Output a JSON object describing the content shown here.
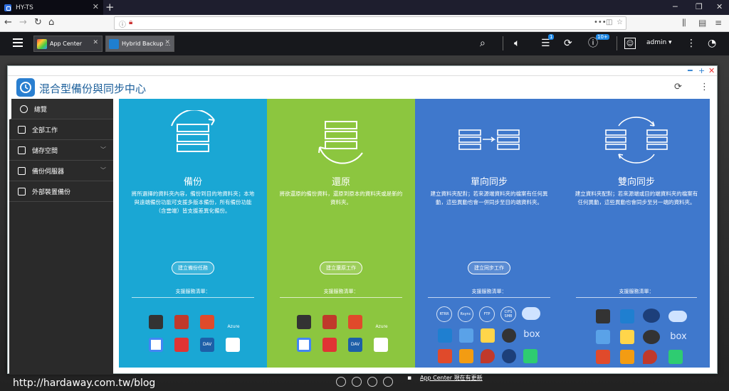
{
  "browser": {
    "tab_title": "HY-TS",
    "new_tab": "+",
    "url": "",
    "min": "─",
    "restore": "❐",
    "close": "✕"
  },
  "qnap": {
    "tabs": [
      {
        "label": "App Center",
        "close": "✕"
      },
      {
        "label": "Hybrid Backup ...",
        "close": "✕"
      }
    ],
    "user": "admin ▾",
    "badges": {
      "notify": "1",
      "info": "10+"
    }
  },
  "window": {
    "title": "混合型備份與同步中心",
    "min": "━",
    "max": "+",
    "close": "✕"
  },
  "sidebar": {
    "items": [
      {
        "label": "總覽"
      },
      {
        "label": "全部工作"
      },
      {
        "label": "儲存空間"
      },
      {
        "label": "備份伺服器"
      },
      {
        "label": "外部裝置備份"
      }
    ]
  },
  "panels": [
    {
      "title": "備份",
      "desc": "將所選擇的資料夾內容，備份到目的地資料夾；本地與遠端備份功能可支援多版本備份，所有備份功能（含雲端）皆支援差異化備份。",
      "button": "建立備份任務",
      "services_label": "支援服務清單：",
      "color": "#1aa7d4"
    },
    {
      "title": "還原",
      "desc": "將欲還原的備份資料，還原到原本的資料夾或是新的資料夾。",
      "button": "建立還原工作",
      "services_label": "支援服務清單：",
      "color": "#8cc63f"
    },
    {
      "title": "單向同步",
      "desc": "建立資料夾配對；若來源端資料夾的檔案有任何異動，這些異動也會一併同步至目的端資料夾。",
      "button": "建立同步工作",
      "services_label": "支援服務清單：",
      "color": "#3f78cc",
      "protocols": [
        "RTRR",
        "Rsync",
        "FTP",
        "CIFS SMB"
      ]
    },
    {
      "title": "雙向同步",
      "desc": "建立資料夾配對；若來源端或目的端資料夾的檔案有任何異動，這些異動也會同步至另一端的資料夾。",
      "button": "",
      "services_label": "支援服務清單：",
      "color": "#3f78cc"
    }
  ],
  "services_text": {
    "azure": "Azure",
    "box": "box",
    "dav": "DAV"
  },
  "notification": "App Center 現在有更新",
  "watermark": "http://hardaway.com.tw/blog"
}
